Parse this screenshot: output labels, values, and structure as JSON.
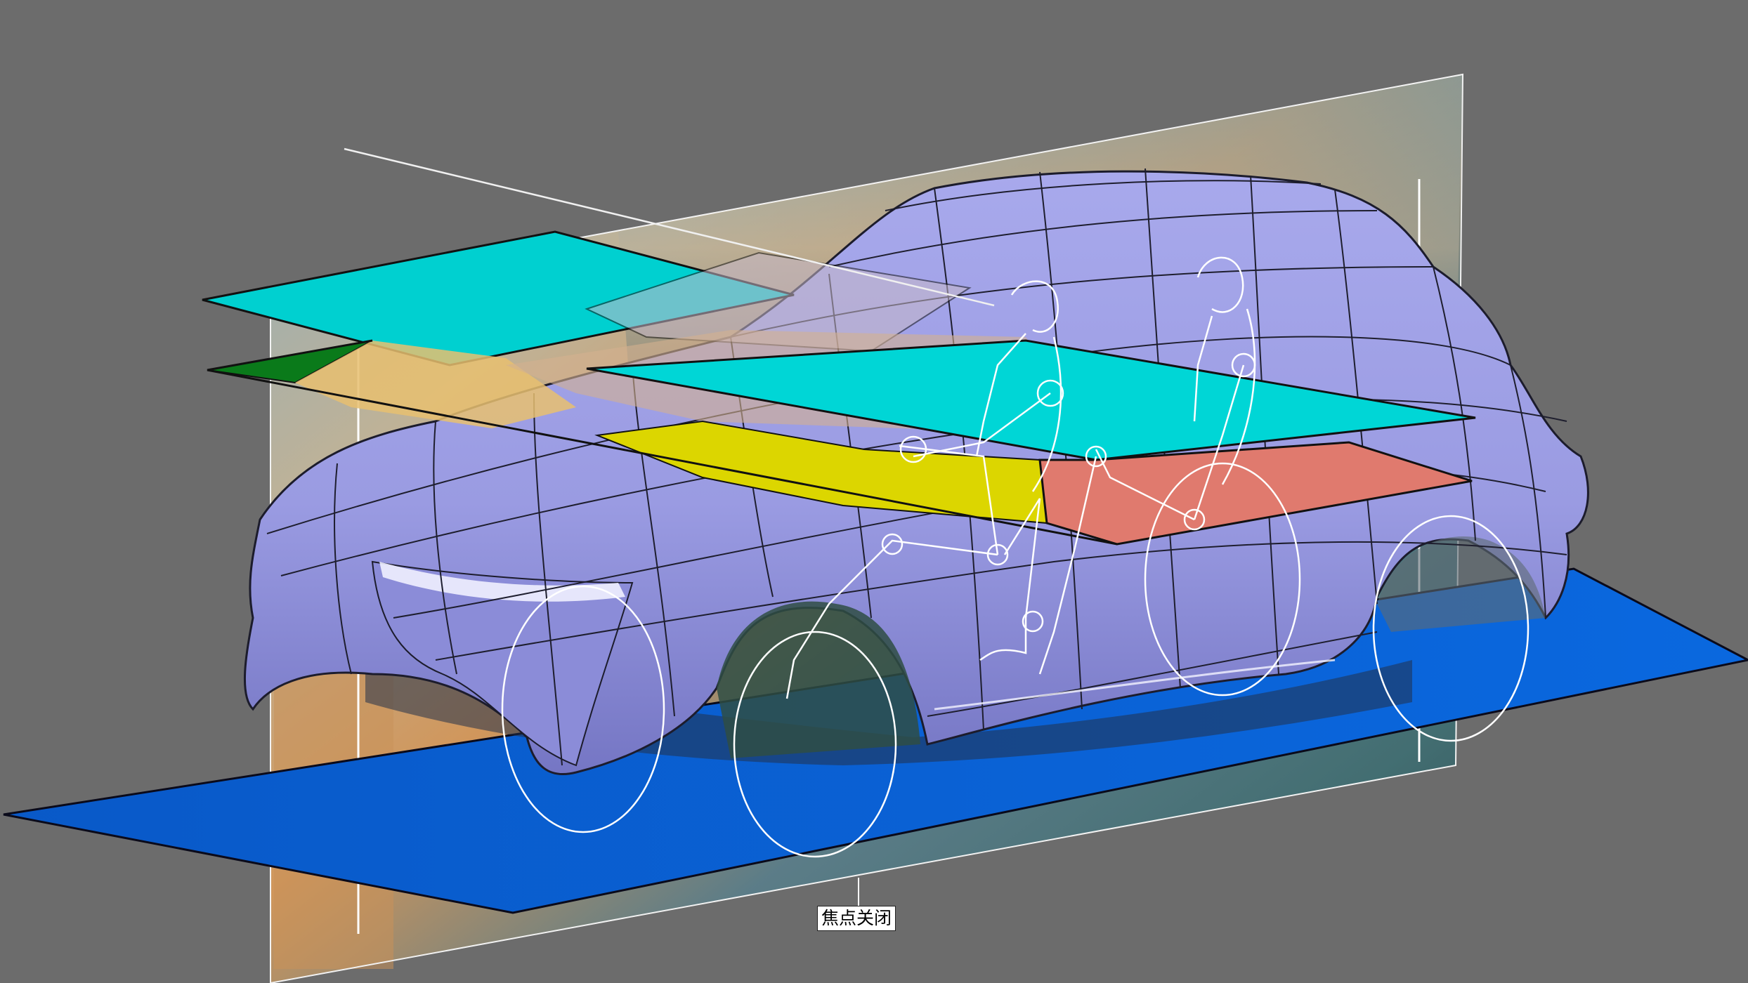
{
  "viewport": {
    "background_color": "#6c6c6c",
    "focus_label": "焦点关闭"
  },
  "scene": {
    "colors": {
      "car_body": "#9d9ee6",
      "car_body_shade": "#7d7fcf",
      "mesh_lines": "#1e1e2e",
      "ground_plane": "#0a62d8",
      "cyan_plane": "#00d6d6",
      "yellow_plane": "#dcd600",
      "red_plane": "#e07a6e",
      "dark_green_plane": "#0a7a1a",
      "wireframe": "#ffffff"
    },
    "elements": [
      "car-surface-model",
      "ground-plane",
      "roof-reference-plane",
      "seating-reference-plane",
      "vertical-background-plane",
      "front-wheel-outline",
      "rear-wheel-outline",
      "driver-manikin",
      "passenger-manikin"
    ]
  }
}
